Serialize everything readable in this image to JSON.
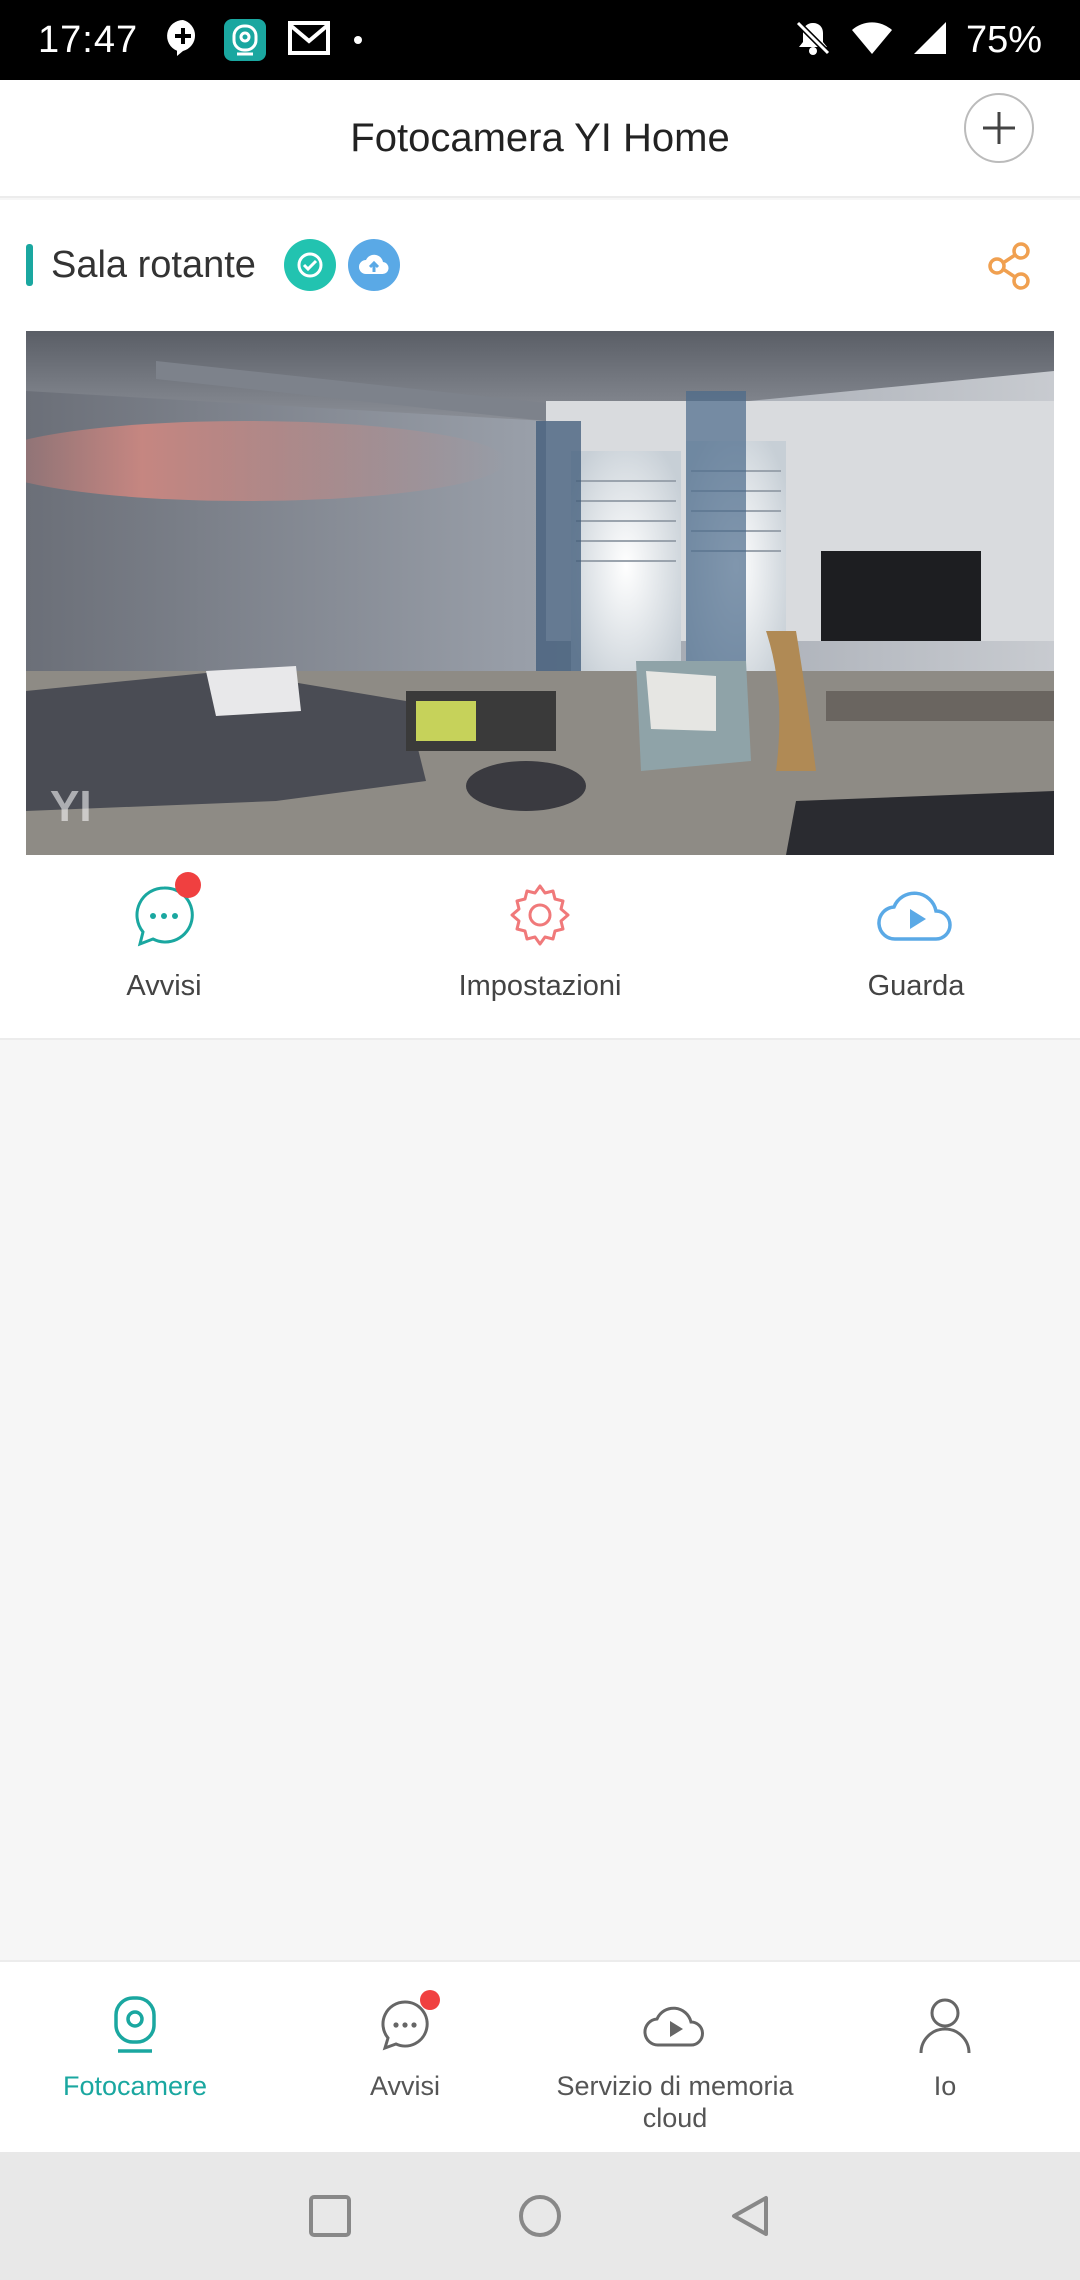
{
  "status_bar": {
    "time": "17:47",
    "battery_percent": "75%",
    "icons": [
      "add-notification-icon",
      "yi-camera-app-icon",
      "gmail-icon",
      "dot-icon",
      "muted-bell-icon",
      "wifi-icon",
      "signal-icon"
    ]
  },
  "header": {
    "title": "Fotocamera YI Home",
    "add_icon": "plus-icon"
  },
  "camera": {
    "name": "Sala rotante",
    "badges": [
      "verified-check-icon",
      "cloud-upload-icon"
    ],
    "share_icon": "share-icon",
    "preview_watermark": "YI"
  },
  "actions": [
    {
      "label": "Avvisi",
      "icon": "chat-bubble-icon",
      "color": "#1aa7a0",
      "has_badge": true
    },
    {
      "label": "Impostazioni",
      "icon": "gear-icon",
      "color": "#f0797a"
    },
    {
      "label": "Guarda",
      "icon": "cloud-play-icon",
      "color": "#5aa9e6"
    }
  ],
  "bottom_nav": [
    {
      "label": "Fotocamere",
      "icon": "camera-icon",
      "active": true
    },
    {
      "label": "Avvisi",
      "icon": "chat-bubble-icon",
      "has_badge": true
    },
    {
      "label": "Servizio di memoria cloud",
      "icon": "cloud-play-icon"
    },
    {
      "label": "Io",
      "icon": "person-icon"
    }
  ],
  "colors": {
    "accent": "#1aa7a0",
    "badge_red": "#f04040",
    "share_orange": "#f0a050",
    "cloud_blue": "#5aa9e6"
  }
}
